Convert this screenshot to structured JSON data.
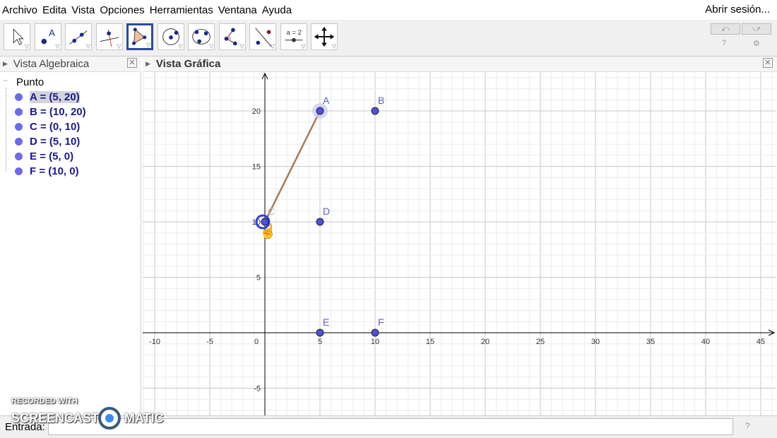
{
  "menu": [
    "Archivo",
    "Edita",
    "Vista",
    "Opciones",
    "Herramientas",
    "Ventana",
    "Ayuda"
  ],
  "login": "Abrir sesión...",
  "tools": [
    "move-tool",
    "point-tool",
    "line-tool",
    "perpendicular-tool",
    "polygon-tool",
    "circle-tool",
    "conic-tool",
    "angle-tool",
    "reflect-tool",
    "slider-tool",
    "move-graphics-tool"
  ],
  "slider_label": "a = 2",
  "algebra": {
    "title": "Vista Algebraica",
    "group": "Punto",
    "items": [
      "A = (5, 20)",
      "B = (10, 20)",
      "C = (0, 10)",
      "D = (5, 10)",
      "E = (5, 0)",
      "F = (10, 0)"
    ]
  },
  "graphics": {
    "title": "Vista Gráfica"
  },
  "chart_data": {
    "type": "scatter",
    "xlim": [
      -11,
      46
    ],
    "ylim": [
      -7.5,
      23.5
    ],
    "xticks": [
      -10,
      -5,
      0,
      5,
      10,
      15,
      20,
      25,
      30,
      35,
      40,
      45
    ],
    "yticks": [
      -5,
      5,
      10,
      15,
      20
    ],
    "points": [
      {
        "name": "A",
        "x": 5,
        "y": 20
      },
      {
        "name": "B",
        "x": 10,
        "y": 20
      },
      {
        "name": "C",
        "x": 0,
        "y": 10
      },
      {
        "name": "D",
        "x": 5,
        "y": 10
      },
      {
        "name": "E",
        "x": 5,
        "y": 0
      },
      {
        "name": "F",
        "x": 10,
        "y": 0
      }
    ],
    "segment": [
      "C",
      "A"
    ],
    "point_color": "#5050e0",
    "segment_color": "#b07850"
  },
  "input": {
    "label": "Entrada:"
  },
  "watermark": {
    "line1": "RECORDED WITH",
    "line2a": "SCREENCAST",
    "line2b": "MATIC"
  }
}
